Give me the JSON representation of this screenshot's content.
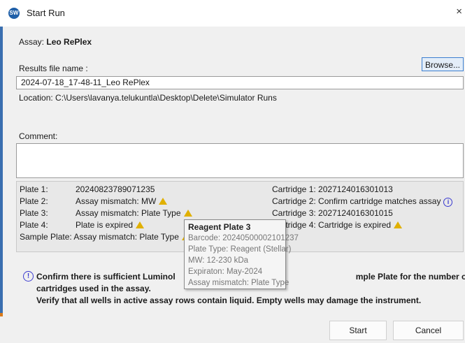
{
  "window": {
    "title": "Start Run",
    "app_icon_text": "SW",
    "close_glyph": "×"
  },
  "assay": {
    "label": "Assay:",
    "name": "Leo RePlex"
  },
  "results": {
    "label": "Results file name :",
    "browse_label": "Browse...",
    "filename": "2024-07-18_17-48-11_Leo RePlex",
    "location_label": "Location:",
    "location_path": "C:\\Users\\lavanya.telukuntla\\Desktop\\Delete\\Simulator Runs"
  },
  "comment": {
    "label": "Comment:",
    "value": ""
  },
  "plates": [
    {
      "label": "Plate 1:",
      "value": "20240823789071235",
      "icon": ""
    },
    {
      "label": "Plate 2:",
      "value": "Assay mismatch: MW",
      "icon": "warning-icon"
    },
    {
      "label": "Plate 3:",
      "value": "Assay mismatch: Plate Type",
      "icon": "warning-icon"
    },
    {
      "label": "Plate 4:",
      "value": "Plate is expired",
      "icon": "warning-icon"
    },
    {
      "label": "Sample Plate:",
      "value": "Assay mismatch: Plate Type",
      "icon": "warning-icon"
    }
  ],
  "cartridges": [
    {
      "label": "Cartridge 1:",
      "value": "2027124016301013",
      "icon": ""
    },
    {
      "label": "Cartridge 2:",
      "value": "Confirm cartridge matches assay",
      "icon": "info-icon"
    },
    {
      "label": "Cartridge 3:",
      "value": "2027124016301015",
      "icon": ""
    },
    {
      "label": "Cartridge 4:",
      "value": "Cartridge is expired",
      "icon": "warning-icon"
    }
  ],
  "tooltip": {
    "title": "Reagent Plate 3",
    "lines": [
      "Barcode: 20240500002101237",
      "Plate Type: Reagent (Stellar)",
      "MW: 12-230 kDa",
      "Expiraton: May-2024",
      "Assay mismatch: Plate Type"
    ]
  },
  "notice": {
    "line1_start": "Confirm there is sufficient Luminol",
    "line1_end": "mple Plate for the number of",
    "line2": "cartridges used in the assay.",
    "line3": "Verify that all wells in active assay rows contain liquid. Empty wells may damage the instrument."
  },
  "buttons": {
    "start": "Start",
    "cancel": "Cancel"
  },
  "colors": {
    "accent": "#3c7fd0",
    "warning": "#e0b000",
    "info": "#3b3bd0",
    "app_icon": "#1f5fa8"
  }
}
